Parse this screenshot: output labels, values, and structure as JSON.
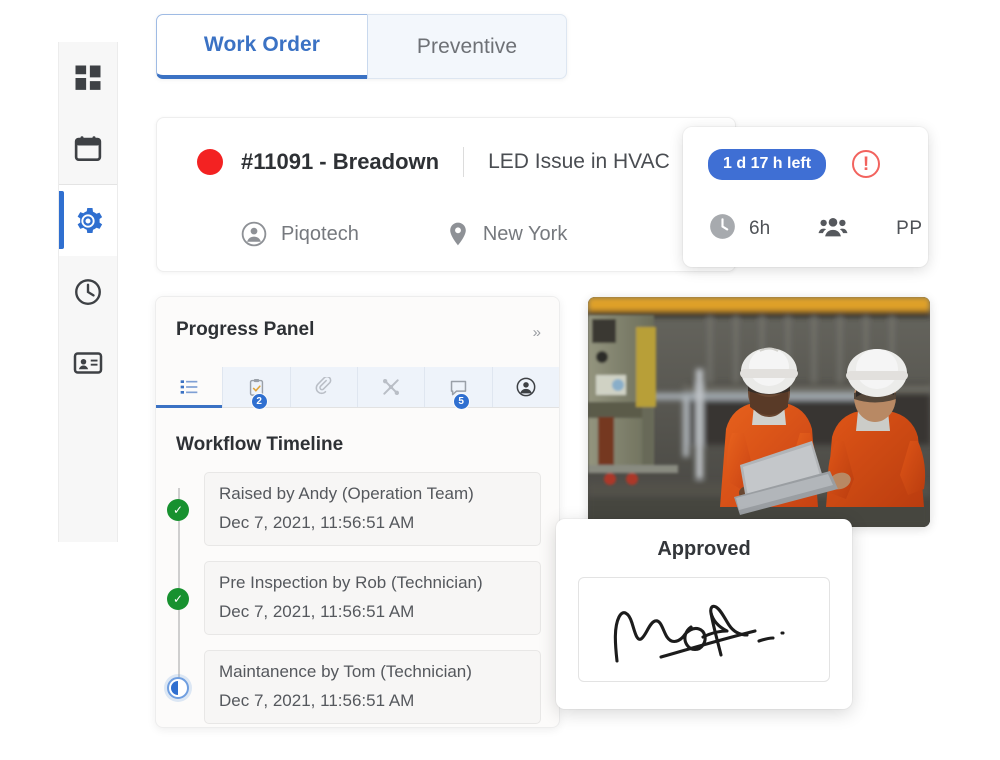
{
  "tabs": {
    "items": [
      {
        "label": "Work Order",
        "active": true
      },
      {
        "label": "Preventive",
        "active": false
      }
    ]
  },
  "work_order": {
    "status_dot": "red-status-dot",
    "id_title": "#11091 - Breadown",
    "subject": "LED Issue in HVAC",
    "company": "Piqotech",
    "location": "New York"
  },
  "sla_card": {
    "time_left_pill": "1 d 17 h left",
    "alert_icon": "exclamation-circle-icon",
    "duration": "6h",
    "team_icon": "people-icon",
    "priority": "PP"
  },
  "sidebar": {
    "items": [
      {
        "name": "dashboard",
        "icon": "grid-dashboard-icon",
        "active": false
      },
      {
        "name": "calendar",
        "icon": "calendar-icon",
        "active": false
      },
      {
        "name": "settings",
        "icon": "gear-icon",
        "active": true
      },
      {
        "name": "history",
        "icon": "clock-icon",
        "active": false
      },
      {
        "name": "contacts",
        "icon": "id-card-icon",
        "active": false
      }
    ]
  },
  "panel": {
    "title": "Progress Panel",
    "expand_icon": "chevron-double-right-icon",
    "tabs": [
      {
        "icon": "list-checklist-icon",
        "badge": "",
        "active": true
      },
      {
        "icon": "clipboard-check-icon",
        "badge": "2",
        "active": false
      },
      {
        "icon": "paperclip-icon",
        "badge": "",
        "active": false
      },
      {
        "icon": "tools-icon",
        "badge": "",
        "active": false
      },
      {
        "icon": "comment-icon",
        "badge": "5",
        "active": false
      },
      {
        "icon": "user-circle-icon",
        "badge": "",
        "active": false
      }
    ],
    "timeline_title": "Workflow Timeline",
    "timeline": [
      {
        "status": "done",
        "title": "Raised by  Andy (Operation Team)",
        "date": "Dec 7, 2021, 11:56:51 AM"
      },
      {
        "status": "done",
        "title": "Pre Inspection by Rob (Technician)",
        "date": "Dec 7, 2021, 11:56:51 AM"
      },
      {
        "status": "in-progress",
        "title": "Maintanence by Tom (Technician)",
        "date": "Dec 7, 2021, 11:56:51 AM"
      }
    ]
  },
  "approved_card": {
    "title": "Approved",
    "signature": "handwritten-signature"
  },
  "photo": {
    "alt": "two-technicians-with-laptop-in-factory"
  },
  "colors": {
    "accent_blue": "#3b72c4",
    "pill_blue": "#3f6fd4",
    "status_red": "#f32222",
    "alert_red": "#f2635e",
    "done_green": "#17912f",
    "hiviz_orange": "#e8561d"
  }
}
